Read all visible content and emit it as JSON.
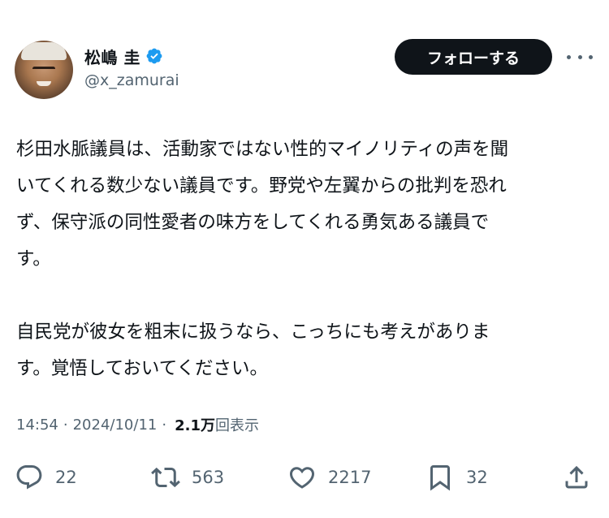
{
  "author": {
    "display_name": "松嶋 圭",
    "handle": "@x_zamurai",
    "avatar": "avatar-photo",
    "verified_color": "#1d9bf0"
  },
  "header": {
    "follow_label": "フォローする"
  },
  "tweet": {
    "text": "杉田水脈議員は、活動家ではない性的マイノリティの声を聞\nいてくれる数少ない議員です。野党や左翼からの批判を恐れ\nず、保守派の同性愛者の味方をしてくれる勇気ある議員で\nす。\n\n自民党が彼女を粗末に扱うなら、こっちにも考えがありま\nす。覚悟しておいてください。",
    "time": "14:54",
    "date": "2024/10/11",
    "views_count": "2.1万",
    "views_label": "回表示"
  },
  "actions": {
    "reply_count": "22",
    "retweet_count": "563",
    "like_count": "2217",
    "bookmark_count": "32"
  },
  "icons": [
    "more-icon",
    "reply-icon",
    "retweet-icon",
    "like-icon",
    "bookmark-icon",
    "share-icon",
    "verified-badge-icon"
  ]
}
